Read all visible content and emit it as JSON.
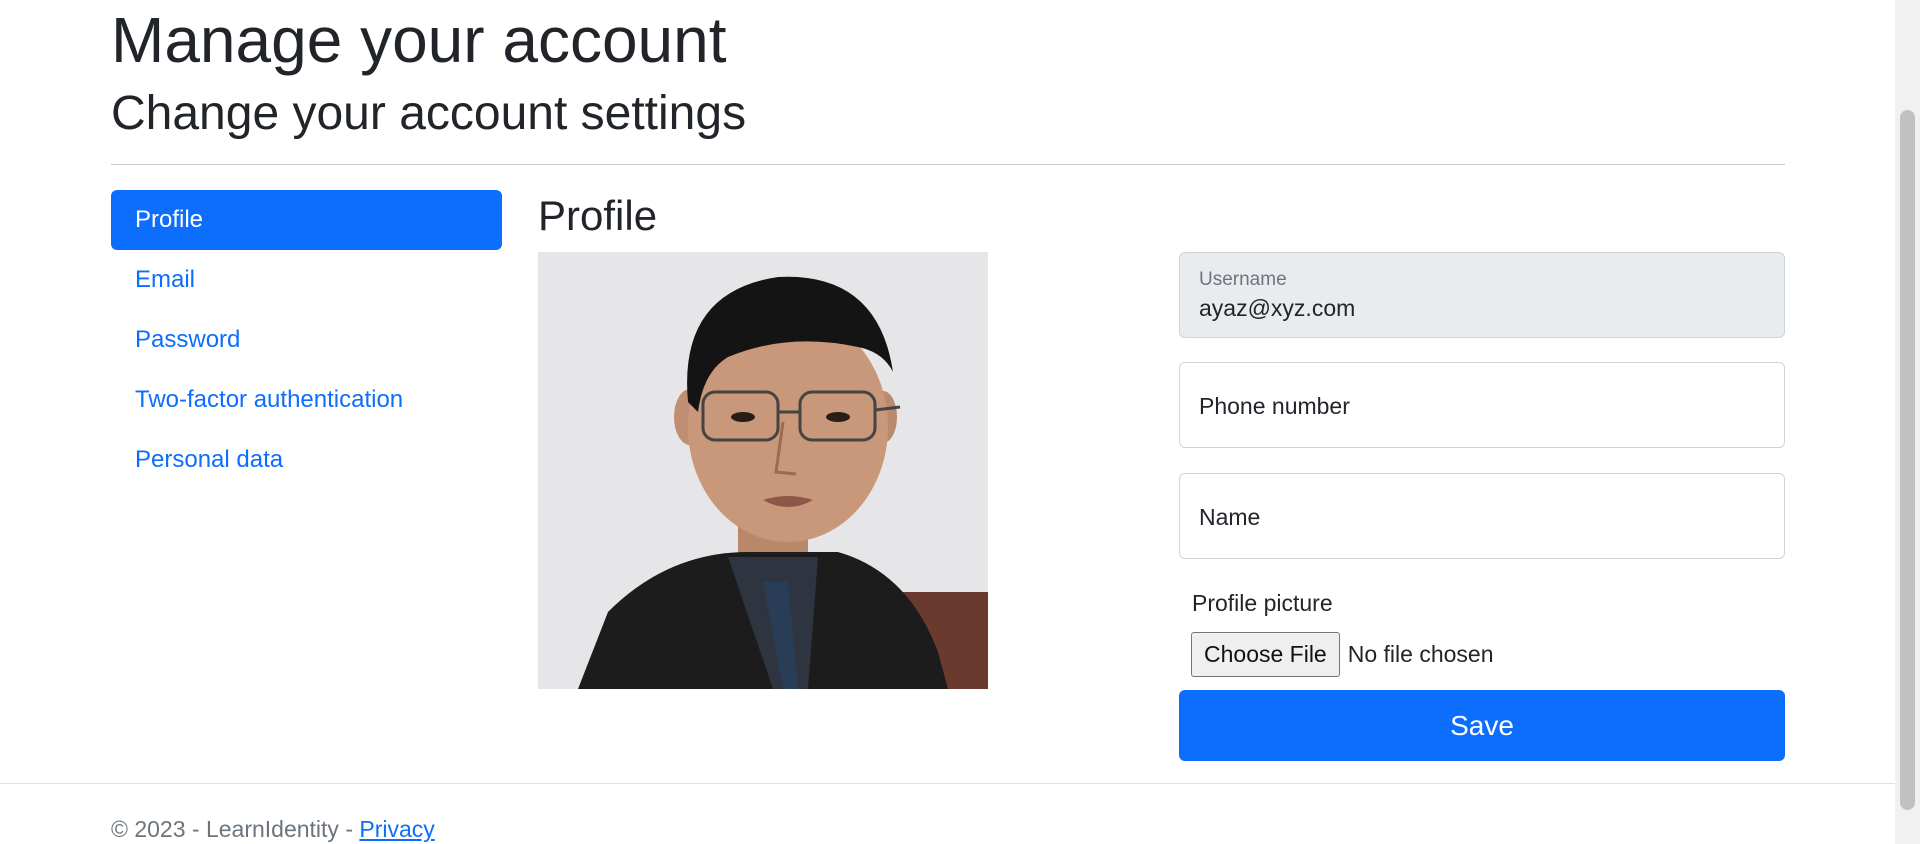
{
  "header": {
    "title": "Manage your account",
    "subtitle": "Change your account settings"
  },
  "nav": {
    "items": [
      {
        "label": "Profile",
        "active": true
      },
      {
        "label": "Email",
        "active": false
      },
      {
        "label": "Password",
        "active": false
      },
      {
        "label": "Two-factor authentication",
        "active": false
      },
      {
        "label": "Personal data",
        "active": false
      }
    ]
  },
  "profile": {
    "section_title": "Profile",
    "photo_icon": "profile-photo"
  },
  "form": {
    "username_label": "Username",
    "username_value": "ayaz@xyz.com",
    "phone_placeholder": "Phone number",
    "name_placeholder": "Name",
    "picture_label": "Profile picture",
    "choose_file_label": "Choose File",
    "file_status": "No file chosen",
    "save_label": "Save"
  },
  "footer": {
    "copyright": "© 2023 - LearnIdentity - ",
    "privacy_link": "Privacy"
  },
  "colors": {
    "primary": "#0d6efd",
    "readonly_bg": "#e9ecef",
    "text": "#212529",
    "muted": "#6c757d"
  }
}
